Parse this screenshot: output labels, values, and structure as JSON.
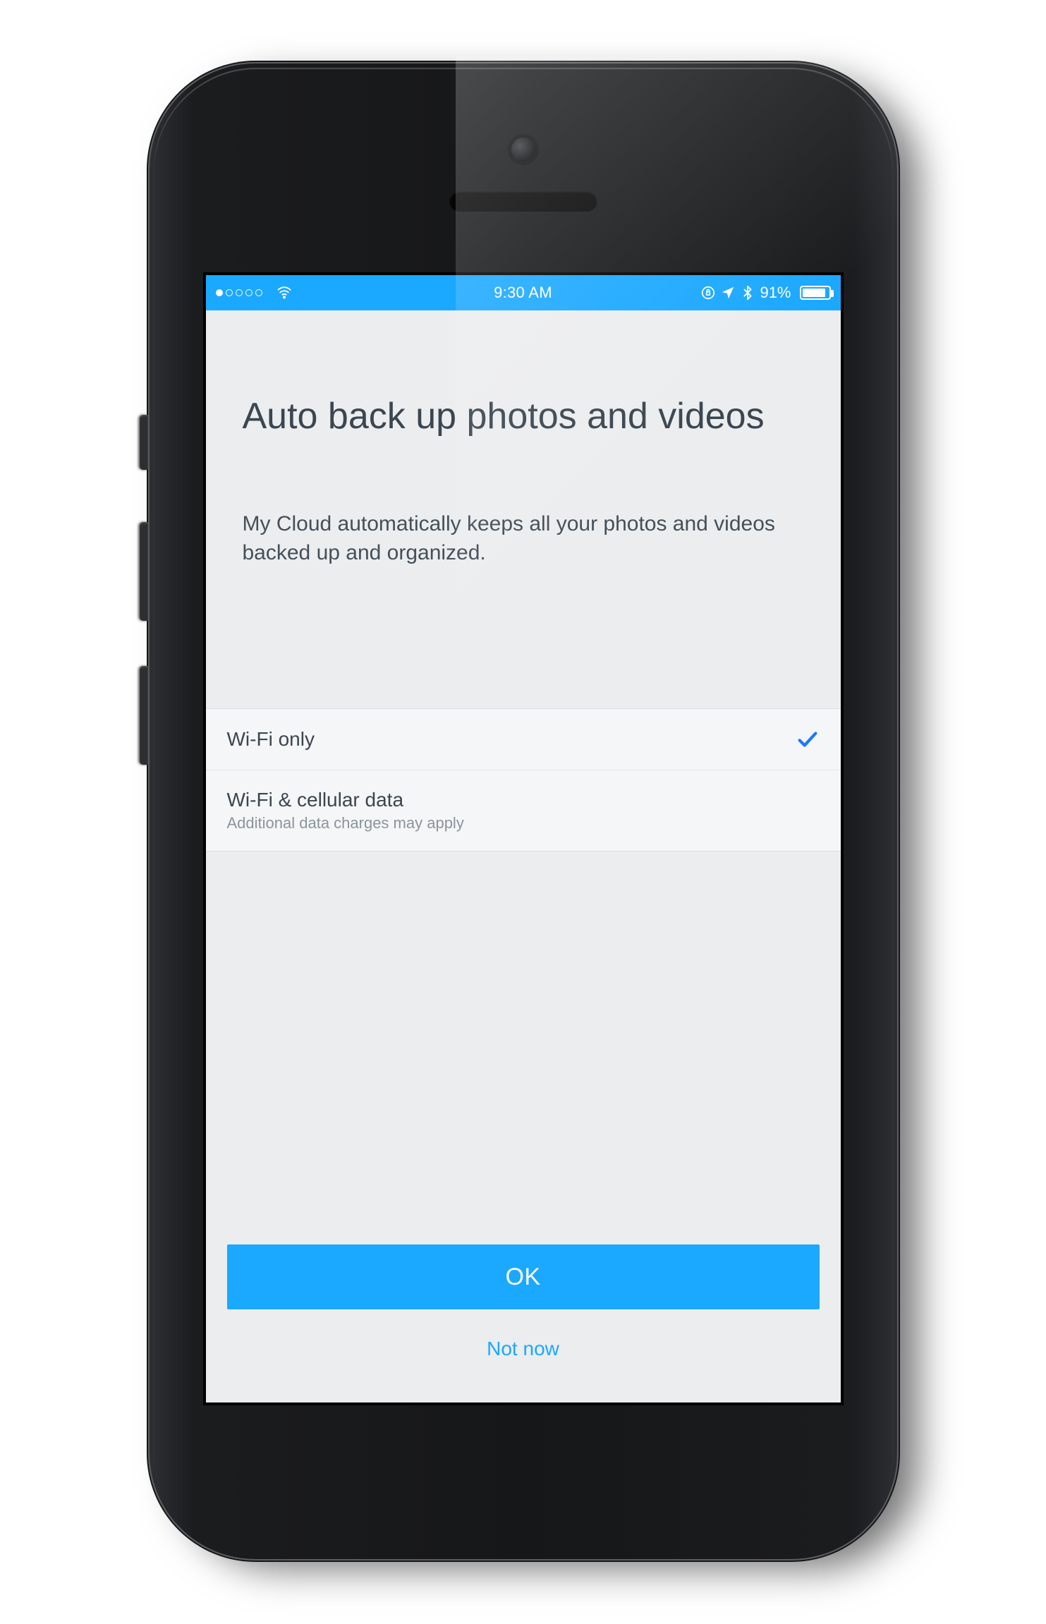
{
  "status_bar": {
    "time": "9:30 AM",
    "battery_percent": "91%",
    "signal_strength": 1
  },
  "page": {
    "title": "Auto back up photos and videos",
    "description": "My Cloud automatically keeps all your photos and videos backed up and organized."
  },
  "options": [
    {
      "label": "Wi-Fi only",
      "subtitle": "",
      "selected": true
    },
    {
      "label": "Wi-Fi & cellular data",
      "subtitle": "Additional data charges may apply",
      "selected": false
    }
  ],
  "buttons": {
    "primary": "OK",
    "secondary": "Not now"
  },
  "colors": {
    "accent": "#1ba8ff",
    "check": "#1a79ff"
  }
}
